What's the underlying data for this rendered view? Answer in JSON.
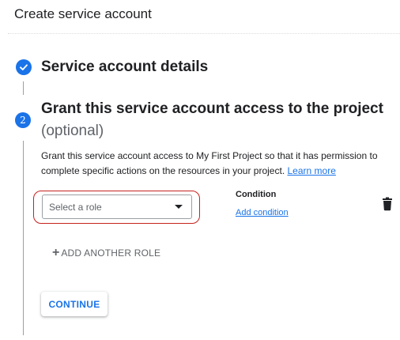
{
  "header": {
    "title": "Create service account"
  },
  "steps": {
    "step1": {
      "title": "Service account details",
      "status_icon": "check-circle-icon"
    },
    "step2": {
      "number": "2",
      "title": "Grant this service account access to the project",
      "optional": "(optional)",
      "description": "Grant this service account access to My First Project so that it has permission to complete specific actions on the resources in your project.",
      "learn_more": "Learn more"
    }
  },
  "role": {
    "placeholder": "Select a role",
    "dropdown_icon": "caret-down-icon"
  },
  "condition": {
    "label": "Condition",
    "add_link": "Add condition"
  },
  "actions": {
    "delete_icon": "trash-icon",
    "add_icon": "plus-icon",
    "add_another_role": "ADD ANOTHER ROLE",
    "continue": "CONTINUE"
  },
  "colors": {
    "accent": "#1a73e8",
    "highlight": "#c5221f",
    "text": "#202124",
    "muted": "#5f6368"
  }
}
